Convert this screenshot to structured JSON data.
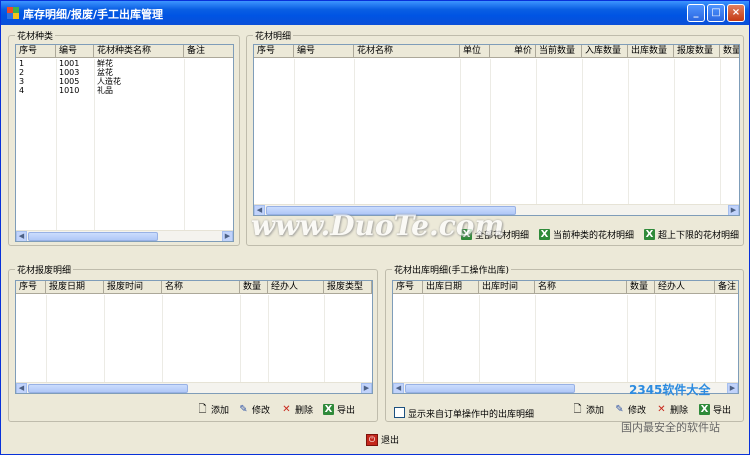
{
  "window": {
    "title": "库存明细/报废/手工出库管理",
    "controls": [
      "_",
      "□",
      "×"
    ]
  },
  "species_panel": {
    "title": "花材种类",
    "columns": [
      "序号",
      "编号",
      "花材种类名称",
      "备注"
    ],
    "rows": [
      [
        "1",
        "1001",
        "鲜花",
        ""
      ],
      [
        "2",
        "1003",
        "盆花",
        ""
      ],
      [
        "3",
        "1005",
        "人造花",
        ""
      ],
      [
        "4",
        "1010",
        "礼品",
        ""
      ]
    ]
  },
  "detail_panel": {
    "title": "花材明细",
    "columns": [
      "序号",
      "编号",
      "花材名称",
      "单位",
      "单价",
      "当前数量",
      "入库数量",
      "出库数量",
      "报废数量",
      "数量"
    ],
    "actions": [
      {
        "label": "全部花材明细",
        "icon": "excel-icon"
      },
      {
        "label": "当前种类的花材明细",
        "icon": "excel-icon"
      },
      {
        "label": "超上下限的花材明细",
        "icon": "excel-icon"
      }
    ]
  },
  "scrap_panel": {
    "title": "花材报废明细",
    "columns": [
      "序号",
      "报废日期",
      "报废时间",
      "名称",
      "数量",
      "经办人",
      "报废类型"
    ],
    "actions": [
      {
        "label": "添加",
        "icon": "add-icon"
      },
      {
        "label": "修改",
        "icon": "edit-icon"
      },
      {
        "label": "删除",
        "icon": "delete-icon"
      },
      {
        "label": "导出",
        "icon": "excel-icon"
      }
    ]
  },
  "outbound_panel": {
    "title": "花材出库明细(手工操作出库)",
    "columns": [
      "序号",
      "出库日期",
      "出库时间",
      "名称",
      "数量",
      "经办人",
      "备注"
    ],
    "checkbox_label": "显示来自订单操作中的出库明细",
    "checkbox_checked": false,
    "actions": [
      {
        "label": "添加",
        "icon": "add-icon"
      },
      {
        "label": "修改",
        "icon": "edit-icon"
      },
      {
        "label": "删除",
        "icon": "delete-icon"
      },
      {
        "label": "导出",
        "icon": "excel-icon"
      }
    ]
  },
  "exit_button": {
    "label": "退出",
    "icon": "exit-icon"
  },
  "watermark": {
    "text": "www.DuoTe.com",
    "logo": "2345软件大全",
    "logo_sub": "国内最安全的软件站"
  }
}
